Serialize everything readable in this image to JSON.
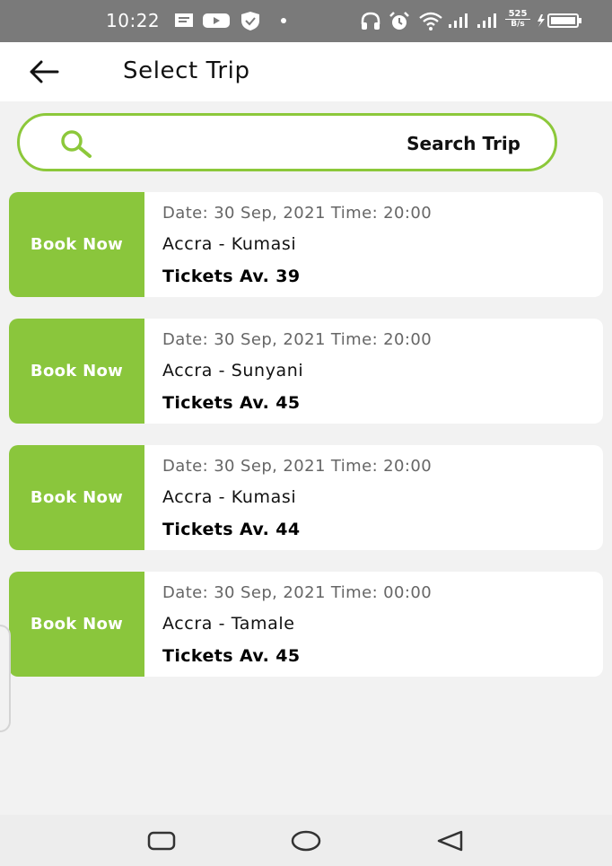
{
  "status_bar": {
    "time": "10:22",
    "net_speed_value": "525",
    "net_speed_unit": "B/s"
  },
  "app_bar": {
    "title": "Select Trip"
  },
  "search": {
    "label": "Search Trip"
  },
  "trips": [
    {
      "button": "Book Now",
      "datetime": "Date: 30 Sep, 2021 Time: 20:00",
      "route": "Accra - Kumasi",
      "tickets": "Tickets Av. 39"
    },
    {
      "button": "Book Now",
      "datetime": "Date: 30 Sep, 2021 Time: 20:00",
      "route": "Accra - Sunyani",
      "tickets": "Tickets Av. 45"
    },
    {
      "button": "Book Now",
      "datetime": "Date: 30 Sep, 2021 Time: 20:00",
      "route": "Accra - Kumasi",
      "tickets": "Tickets Av. 44"
    },
    {
      "button": "Book Now",
      "datetime": "Date: 30 Sep, 2021 Time: 00:00",
      "route": "Accra - Tamale",
      "tickets": "Tickets Av. 45"
    }
  ],
  "colors": {
    "accent": "#8ac63c",
    "status_bar": "#7a7a7a",
    "background": "#f2f2f2"
  },
  "icons": [
    "message-icon",
    "youtube-icon",
    "shield-icon",
    "dot-icon",
    "headset-icon",
    "alarm-icon",
    "wifi-icon",
    "signal-icon",
    "battery-icon",
    "back-arrow-icon",
    "search-icon",
    "recents-icon",
    "home-icon",
    "back-nav-icon"
  ]
}
